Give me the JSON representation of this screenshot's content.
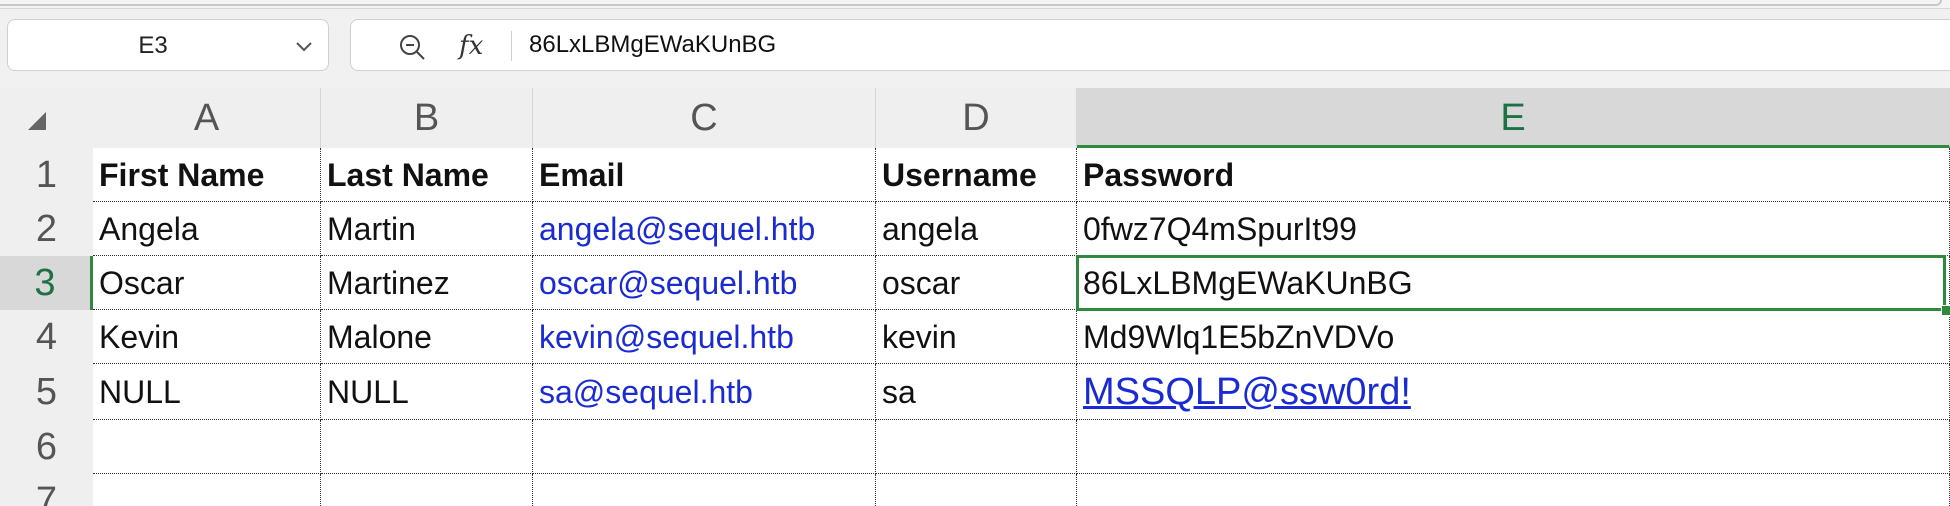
{
  "name_box": {
    "value": "E3"
  },
  "formula_bar": {
    "value": "86LxLBMgEWaKUnBG",
    "fx_label": "fx"
  },
  "sheet": {
    "columns": [
      "A",
      "B",
      "C",
      "D",
      "E"
    ],
    "active_column": "E",
    "active_row": "3",
    "row_numbers": [
      "1",
      "2",
      "3",
      "4",
      "5",
      "6",
      "7"
    ],
    "rows": [
      [
        "First Name",
        "Last Name",
        "Email",
        "Username",
        "Password"
      ],
      [
        "Angela",
        "Martin",
        "angela@sequel.htb",
        "angela",
        "0fwz7Q4mSpurIt99"
      ],
      [
        "Oscar",
        "Martinez",
        "oscar@sequel.htb",
        "oscar",
        "86LxLBMgEWaKUnBG"
      ],
      [
        "Kevin",
        "Malone",
        "kevin@sequel.htb",
        "kevin",
        "Md9Wlq1E5bZnVDVo"
      ],
      [
        "NULL",
        "NULL",
        "sa@sequel.htb",
        "sa",
        "MSSQLP@ssw0rd!"
      ],
      [
        "",
        "",
        "",
        "",
        ""
      ],
      [
        "",
        "",
        "",
        "",
        ""
      ]
    ]
  },
  "colors": {
    "accent": "#2f8a3e",
    "link": "#1a2bd6"
  }
}
